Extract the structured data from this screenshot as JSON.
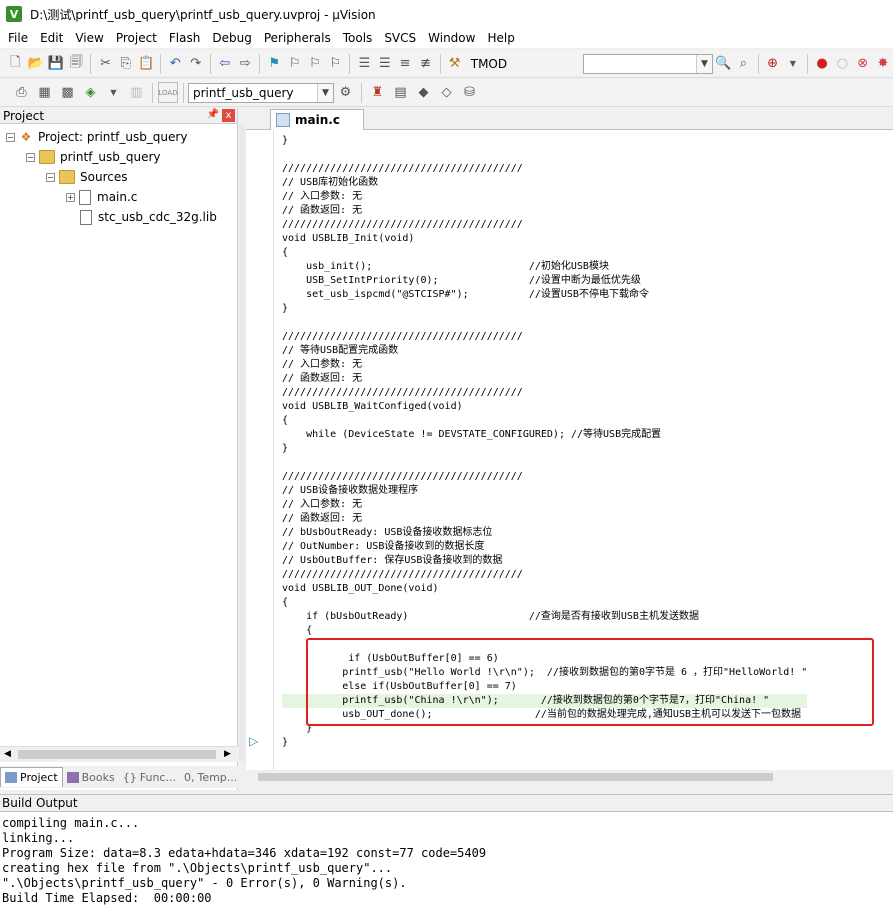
{
  "window": {
    "title": "D:\\测试\\printf_usb_query\\printf_usb_query.uvproj - µVision",
    "icon_letter": "V"
  },
  "menu": [
    "File",
    "Edit",
    "View",
    "Project",
    "Flash",
    "Debug",
    "Peripherals",
    "Tools",
    "SVCS",
    "Window",
    "Help"
  ],
  "toolbar1": {
    "target_combo_value": "TMOD"
  },
  "toolbar2": {
    "project_combo_value": "printf_usb_query",
    "load_label": "LOAD"
  },
  "project_panel": {
    "title": "Project",
    "pin_icon": "pin-icon",
    "close_label": "x",
    "tree": {
      "root": "Project: printf_usb_query",
      "target": "printf_usb_query",
      "group": "Sources",
      "files": [
        "main.c",
        "stc_usb_cdc_32g.lib"
      ]
    },
    "tabs": [
      "Project",
      "Books",
      "Func...",
      "Temp..."
    ]
  },
  "editor": {
    "tab_label": "main.c",
    "lines": [
      "}",
      "",
      "////////////////////////////////////////",
      "// USB库初始化函数",
      "// 入口参数: 无",
      "// 函数返回: 无",
      "////////////////////////////////////////",
      "void USBLIB_Init(void)",
      "{",
      "    usb_init();                          //初始化USB模块",
      "    USB_SetIntPriority(0);               //设置中断为最低优先级",
      "    set_usb_ispcmd(\"@STCISP#\");          //设置USB不停电下载命令",
      "}",
      "",
      "////////////////////////////////////////",
      "// 等待USB配置完成函数",
      "// 入口参数: 无",
      "// 函数返回: 无",
      "////////////////////////////////////////",
      "void USBLIB_WaitConfiged(void)",
      "{",
      "    while (DeviceState != DEVSTATE_CONFIGURED); //等待USB完成配置",
      "}",
      "",
      "////////////////////////////////////////",
      "// USB设备接收数据处理程序",
      "// 入口参数: 无",
      "// 函数返回: 无",
      "// bUsbOutReady: USB设备接收数据标志位",
      "// OutNumber: USB设备接收到的数据长度",
      "// UsbOutBuffer: 保存USB设备接收到的数据",
      "////////////////////////////////////////",
      "void USBLIB_OUT_Done(void)",
      "{",
      "    if (bUsbOutReady)                    //查询是否有接收到USB主机发送数据",
      "    {",
      "",
      "           if (UsbOutBuffer[0] == 6)",
      "          printf_usb(\"Hello World !\\r\\n\");  //接收到数据包的第0字节是 6 ，打印\"HelloWorld! \"",
      "          else if(UsbOutBuffer[0] == 7)",
      "          printf_usb(\"China !\\r\\n\");       //接收到数据包的第0个字节是7，打印\"China! \"",
      "          usb_OUT_done();                 //当前包的数据处理完成,通知USB主机可以发送下一包数据",
      "    }",
      "}"
    ],
    "highlighted_line_index": 40
  },
  "build_output": {
    "title": "Build Output",
    "lines": [
      "compiling main.c...",
      "linking...",
      "Program Size: data=8.3 edata+hdata=346 xdata=192 const=77 code=5409",
      "creating hex file from \".\\Objects\\printf_usb_query\"...",
      "\".\\Objects\\printf_usb_query\" - 0 Error(s), 0 Warning(s).",
      "Build Time Elapsed:  00:00:00"
    ]
  },
  "colors": {
    "annotation_box": "#e02020",
    "current_line_bg": "#e6f5e0",
    "app_icon": "#3a8d2c"
  }
}
